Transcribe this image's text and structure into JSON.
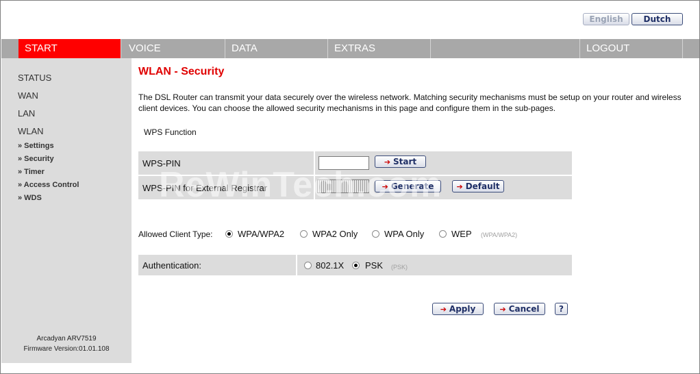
{
  "language": {
    "english": "English",
    "dutch": "Dutch"
  },
  "nav": {
    "items": [
      "START",
      "VOICE",
      "DATA",
      "EXTRAS",
      "",
      "LOGOUT"
    ],
    "active_color": "#ff0000"
  },
  "sidebar": {
    "items": [
      "STATUS",
      "WAN",
      "LAN",
      "WLAN"
    ],
    "subitems": [
      "» Settings",
      "» Security",
      "» Timer",
      "» Access Control",
      "» WDS"
    ],
    "device": "Arcadyan ARV7519",
    "firmware": "Firmware Version:01.01.108"
  },
  "page": {
    "title": "WLAN - Security",
    "description": "The DSL Router can transmit your data securely over the wireless network. Matching security mechanisms must be setup on your router and wireless client devices. You can choose the allowed security mechanisms in this page and configure them in the sub-pages.",
    "wps_section": "WPS Function"
  },
  "wps": {
    "pin_label": "WPS-PIN",
    "pin_value": "",
    "start_label": "Start",
    "ext_label": "WPS-PIN for External Registrar",
    "generate_label": "Generate",
    "default_label": "Default"
  },
  "client_type": {
    "label": "Allowed Client Type:",
    "options": [
      "WPA/WPA2",
      "WPA2 Only",
      "WPA Only",
      "WEP"
    ],
    "selected": "WPA/WPA2",
    "hint": "(WPA/WPA2)"
  },
  "auth": {
    "label": "Authentication:",
    "options": [
      "802.1X",
      "PSK"
    ],
    "selected": "PSK",
    "hint": "(PSK)"
  },
  "actions": {
    "apply": "Apply",
    "cancel": "Cancel",
    "help": "?"
  },
  "watermark": "ReWinTech.com"
}
